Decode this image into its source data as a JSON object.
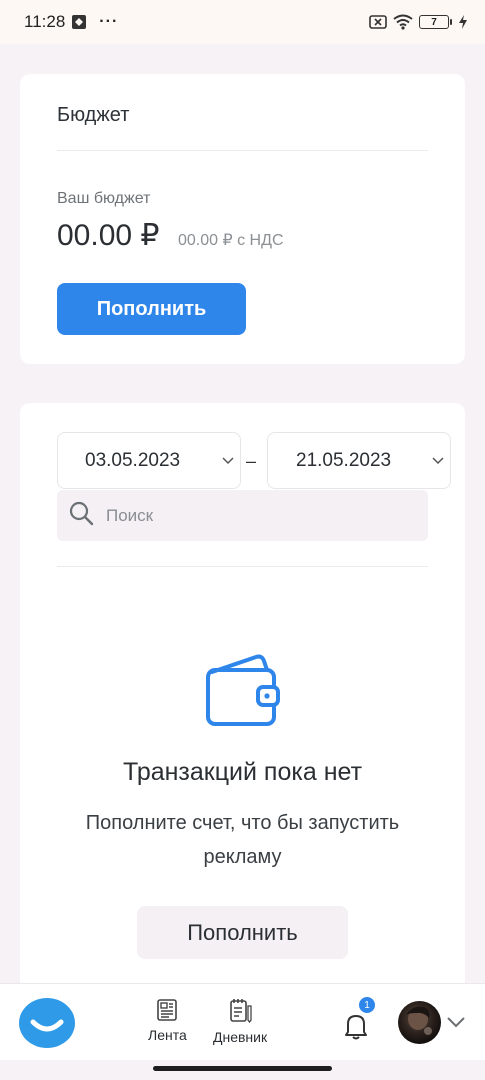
{
  "status_bar": {
    "time": "11:28",
    "dots": "···",
    "battery": "7"
  },
  "budget_card": {
    "title": "Бюджет",
    "budget_label": "Ваш бюджет",
    "amount": "00.00 ₽",
    "amount_with_vat": "00.00 ₽ с НДС",
    "topup_label": "Пополнить"
  },
  "transactions_card": {
    "date_from": "03.05.2023",
    "date_separator": "–",
    "date_to": "21.05.2023",
    "search_placeholder": "Поиск",
    "empty_title": "Транзакций пока нет",
    "empty_text": "Пополните счет, что бы запустить рекламу",
    "topup_label": "Пополнить"
  },
  "bottom_nav": {
    "feed_label": "Лента",
    "diary_label": "Дневник",
    "notifications_count": "1"
  },
  "colors": {
    "accent": "#2f86ea",
    "background": "#f6f2f5",
    "card": "#ffffff"
  }
}
